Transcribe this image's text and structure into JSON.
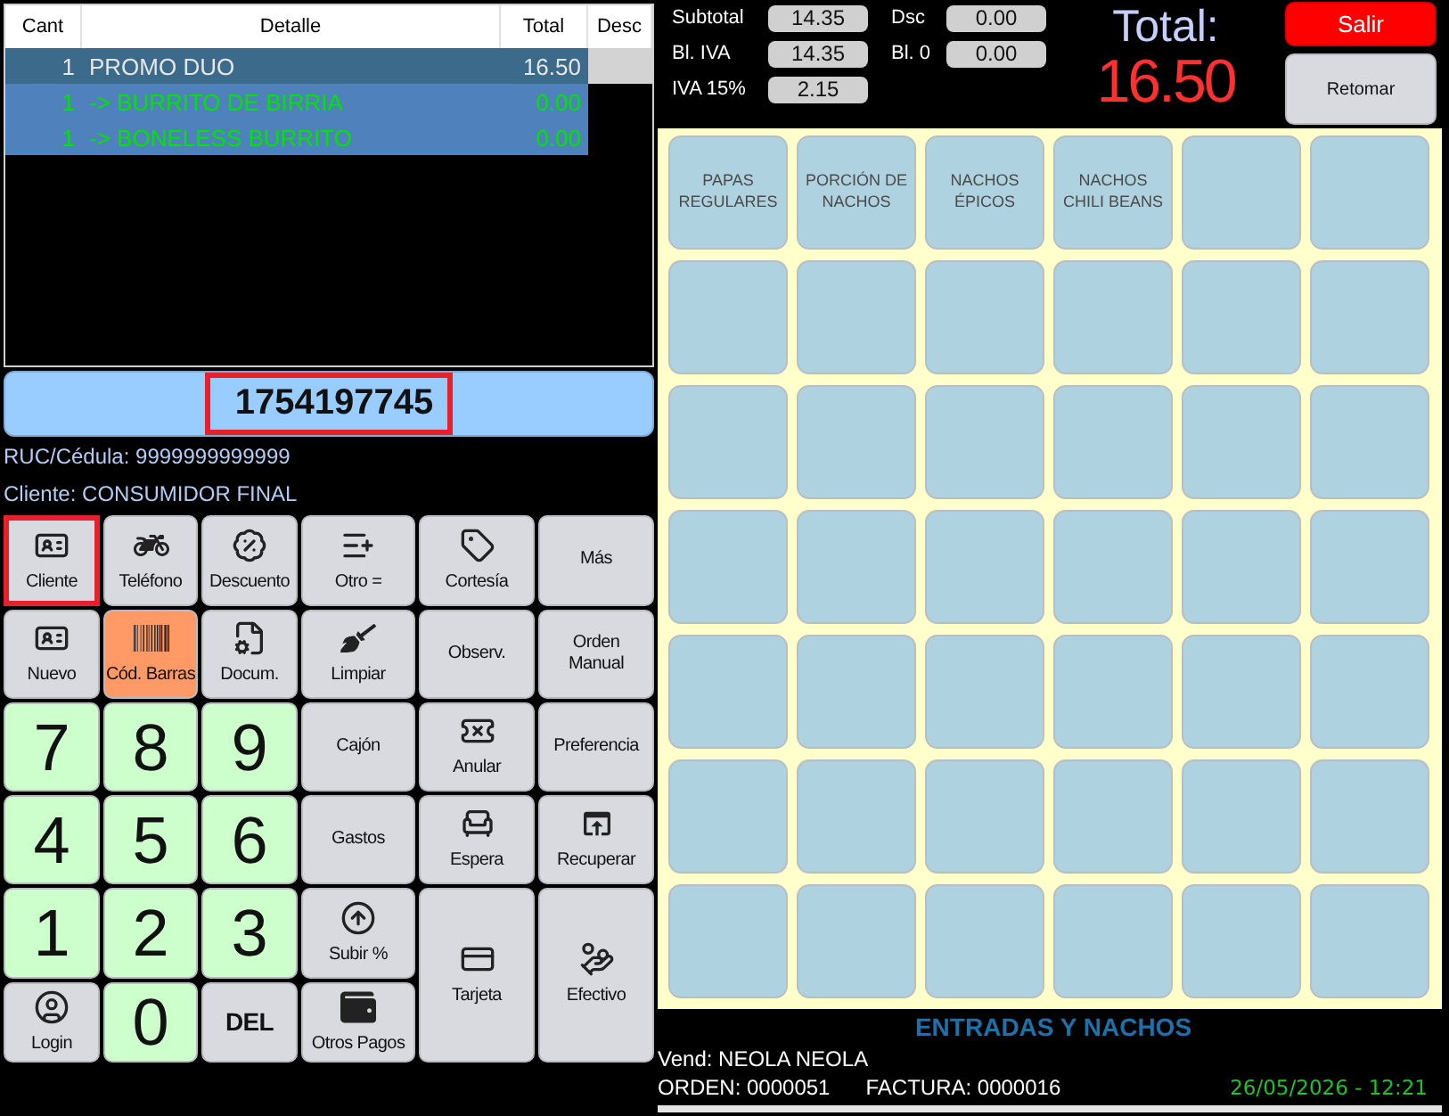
{
  "order_table": {
    "columns": [
      "Cant",
      "Detalle",
      "Total",
      "Desc"
    ],
    "rows": [
      {
        "kind": "item",
        "selected": true,
        "cant": "1",
        "detail": "PROMO DUO",
        "total": "16.50"
      },
      {
        "kind": "component",
        "selected": false,
        "cant": "1",
        "detail": "-> BURRITO DE BIRRIA",
        "total": "0.00"
      },
      {
        "kind": "component",
        "selected": false,
        "cant": "1",
        "detail": "-> BONELESS BURRITO",
        "total": "0.00"
      }
    ]
  },
  "barcode_field": {
    "value": "1754197745",
    "highlighted": true
  },
  "customer": {
    "ruc": "RUC/Cédula: 9999999999999",
    "client": "Cliente: CONSUMIDOR FINAL"
  },
  "keypad": [
    {
      "label": "Cliente",
      "kind": "action",
      "active": false,
      "highlighted": true
    },
    {
      "label": "Teléfono",
      "kind": "action",
      "active": false,
      "highlighted": false
    },
    {
      "label": "Descuento",
      "kind": "action",
      "active": false,
      "highlighted": false
    },
    {
      "label": "Otro =",
      "kind": "action",
      "active": false,
      "highlighted": false
    },
    {
      "label": "Cortesía",
      "kind": "action",
      "active": false,
      "highlighted": false
    },
    {
      "label": "Más",
      "kind": "action",
      "active": false,
      "highlighted": false
    },
    {
      "label": "Nuevo",
      "kind": "action",
      "active": false,
      "highlighted": false
    },
    {
      "label": "Cód. Barras",
      "kind": "action",
      "active": true,
      "highlighted": false
    },
    {
      "label": "Docum.",
      "kind": "action",
      "active": false,
      "highlighted": false
    },
    {
      "label": "Limpiar",
      "kind": "action",
      "active": false,
      "highlighted": false
    },
    {
      "label": "Observ.",
      "kind": "action",
      "active": false,
      "highlighted": false
    },
    {
      "label": "Orden Manual",
      "kind": "action",
      "active": false,
      "highlighted": false
    },
    {
      "label": "7",
      "kind": "digit",
      "active": false,
      "highlighted": false
    },
    {
      "label": "8",
      "kind": "digit",
      "active": false,
      "highlighted": false
    },
    {
      "label": "9",
      "kind": "digit",
      "active": false,
      "highlighted": false
    },
    {
      "label": "Cajón",
      "kind": "action",
      "active": false,
      "highlighted": false
    },
    {
      "label": "Anular",
      "kind": "action",
      "active": false,
      "highlighted": false
    },
    {
      "label": "Preferencia",
      "kind": "action",
      "active": false,
      "highlighted": false
    },
    {
      "label": "4",
      "kind": "digit",
      "active": false,
      "highlighted": false
    },
    {
      "label": "5",
      "kind": "digit",
      "active": false,
      "highlighted": false
    },
    {
      "label": "6",
      "kind": "digit",
      "active": false,
      "highlighted": false
    },
    {
      "label": "Gastos",
      "kind": "action",
      "active": false,
      "highlighted": false
    },
    {
      "label": "Espera",
      "kind": "action",
      "active": false,
      "highlighted": false
    },
    {
      "label": "Recuperar",
      "kind": "action",
      "active": false,
      "highlighted": false
    },
    {
      "label": "1",
      "kind": "digit",
      "active": false,
      "highlighted": false
    },
    {
      "label": "2",
      "kind": "digit",
      "active": false,
      "highlighted": false
    },
    {
      "label": "3",
      "kind": "digit",
      "active": false,
      "highlighted": false
    },
    {
      "label": "Subir %",
      "kind": "action",
      "active": false,
      "highlighted": false
    },
    {
      "label": "Tarjeta",
      "kind": "payment",
      "active": false,
      "highlighted": false
    },
    {
      "label": "Efectivo",
      "kind": "payment",
      "active": false,
      "highlighted": false
    },
    {
      "label": "Login",
      "kind": "action",
      "active": false,
      "highlighted": false
    },
    {
      "label": "0",
      "kind": "digit",
      "active": false,
      "highlighted": false
    },
    {
      "label": "DEL",
      "kind": "delete",
      "active": false,
      "highlighted": false
    },
    {
      "label": "Otros Pagos",
      "kind": "action",
      "active": false,
      "highlighted": false
    }
  ],
  "totals": [
    {
      "label": "Subtotal",
      "value": "14.35"
    },
    {
      "label": "Bl. IVA",
      "value": "14.35"
    },
    {
      "label": "IVA 15%",
      "value": "2.15"
    },
    {
      "label": "Dsc",
      "value": "0.00"
    },
    {
      "label": "Bl. 0",
      "value": "0.00"
    }
  ],
  "grand_total": {
    "label": "Total:",
    "value": "16.50"
  },
  "actions": [
    {
      "label": "Salir",
      "kind": "danger"
    },
    {
      "label": "Retomar",
      "kind": "normal"
    }
  ],
  "product_tiles": [
    {
      "kind": "product",
      "label": "PAPAS REGULARES"
    },
    {
      "kind": "product",
      "label": "PORCIÓN DE NACHOS"
    },
    {
      "kind": "product",
      "label": "NACHOS ÉPICOS"
    },
    {
      "kind": "product",
      "label": "NACHOS CHILI BEANS"
    },
    {
      "kind": "empty"
    },
    {
      "kind": "empty"
    },
    {
      "kind": "empty"
    },
    {
      "kind": "empty"
    },
    {
      "kind": "empty"
    },
    {
      "kind": "empty"
    },
    {
      "kind": "empty"
    },
    {
      "kind": "empty"
    },
    {
      "kind": "empty"
    },
    {
      "kind": "empty"
    },
    {
      "kind": "empty"
    },
    {
      "kind": "empty"
    },
    {
      "kind": "empty"
    },
    {
      "kind": "empty"
    },
    {
      "kind": "empty"
    },
    {
      "kind": "empty"
    },
    {
      "kind": "empty"
    },
    {
      "kind": "empty"
    },
    {
      "kind": "empty"
    },
    {
      "kind": "empty"
    },
    {
      "kind": "empty"
    },
    {
      "kind": "empty"
    },
    {
      "kind": "empty"
    },
    {
      "kind": "empty"
    },
    {
      "kind": "empty"
    },
    {
      "kind": "empty"
    },
    {
      "kind": "empty"
    },
    {
      "kind": "empty"
    },
    {
      "kind": "empty"
    },
    {
      "kind": "empty"
    },
    {
      "kind": "empty"
    },
    {
      "kind": "empty"
    },
    {
      "kind": "empty"
    },
    {
      "kind": "empty"
    },
    {
      "kind": "empty"
    },
    {
      "kind": "empty"
    },
    {
      "kind": "empty"
    },
    {
      "kind": "empty"
    }
  ],
  "category": "ENTRADAS Y NACHOS",
  "footer": {
    "vendor": "Vend: NEOLA NEOLA",
    "order": "ORDEN: 0000051",
    "invoice": "FACTURA: 0000016",
    "datetime": "26/05/2026 - 12:21"
  }
}
